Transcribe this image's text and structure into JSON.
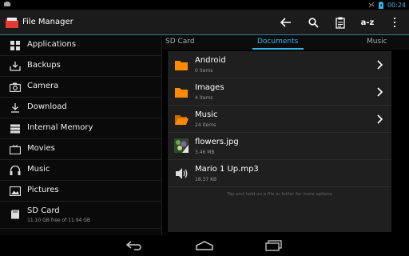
{
  "status_bar": {
    "time": "00:24"
  },
  "action_bar": {
    "title": "File Manager",
    "sort_label": "a-z"
  },
  "drawer": {
    "items": [
      {
        "label": "Applications",
        "icon": "apps-grid-icon"
      },
      {
        "label": "Backups",
        "icon": "download-tray-icon"
      },
      {
        "label": "Camera",
        "icon": "camera-icon"
      },
      {
        "label": "Download",
        "icon": "download-icon"
      },
      {
        "label": "Internal Memory",
        "icon": "storage-icon"
      },
      {
        "label": "Movies",
        "icon": "tv-icon"
      },
      {
        "label": "Music",
        "icon": "headphones-icon"
      },
      {
        "label": "Pictures",
        "icon": "picture-icon"
      },
      {
        "label": "SD Card",
        "sub": "11.10 GB free of 11.94 GB",
        "icon": "sd-card-icon"
      }
    ]
  },
  "tabs": [
    {
      "label": "SD Card"
    },
    {
      "label": "Documents"
    },
    {
      "label": "Music"
    }
  ],
  "files": [
    {
      "name": "Android",
      "meta": "0 items",
      "type": "folder",
      "icon": "folder-icon"
    },
    {
      "name": "Images",
      "meta": "4 items",
      "type": "folder",
      "icon": "folder-icon"
    },
    {
      "name": "Music",
      "meta": "24 items",
      "type": "folder-open",
      "icon": "folder-open-icon"
    },
    {
      "name": "flowers.jpg",
      "meta": "3.46 MB",
      "type": "image",
      "icon": "image-thumbnail-icon"
    },
    {
      "name": "Mario 1 Up.mp3",
      "meta": "18.37 KB",
      "type": "audio",
      "icon": "speaker-icon"
    }
  ],
  "hint_text": "Tap and hold on a file or folder for more options",
  "colors": {
    "accent": "#33b5e5",
    "folder": "#ff8a00",
    "battery": "#33b5e5"
  }
}
